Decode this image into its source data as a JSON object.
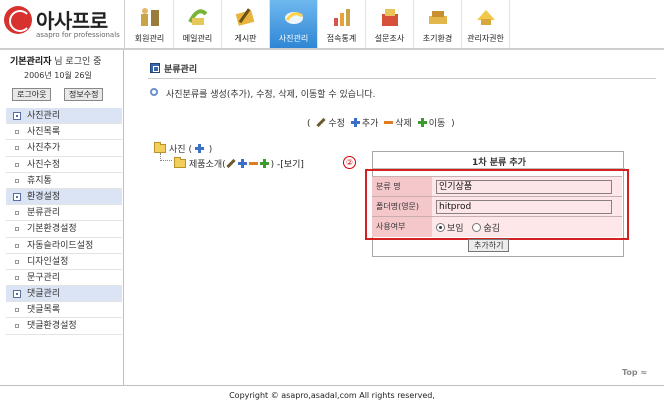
{
  "brand": {
    "name": "아사프로",
    "tagline": "asapro for professionals"
  },
  "colors": {
    "accent": "#2f86d4",
    "highlight_frame": "#d42020",
    "form_label_bg": "#f4c7ca",
    "nav_category_bg": "#dbe4f4"
  },
  "menu": [
    {
      "label": "회원관리",
      "icon": "members-icon"
    },
    {
      "label": "메일관리",
      "icon": "mail-icon"
    },
    {
      "label": "게시판",
      "icon": "board-icon"
    },
    {
      "label": "사진관리",
      "icon": "photo-icon",
      "active": true
    },
    {
      "label": "접속통계",
      "icon": "statistics-icon"
    },
    {
      "label": "설문조사",
      "icon": "survey-icon"
    },
    {
      "label": "초기환경",
      "icon": "init-settings-icon"
    },
    {
      "label": "관리자권한",
      "icon": "admin-permission-icon"
    }
  ],
  "sidebar": {
    "user_name": "기본관리자",
    "user_suffix": " 님 로그인 중",
    "date": "2006년 10월 26일",
    "logout_label": "로그아웃",
    "edit_info_label": "정보수정",
    "nav": [
      {
        "label": "사진관리",
        "type": "category"
      },
      {
        "label": "사진목록",
        "type": "item"
      },
      {
        "label": "사진추가",
        "type": "item"
      },
      {
        "label": "사진수정",
        "type": "item"
      },
      {
        "label": "휴지통",
        "type": "item"
      },
      {
        "label": "환경설정",
        "type": "category"
      },
      {
        "label": "분류관리",
        "type": "item"
      },
      {
        "label": "기본환경설정",
        "type": "item"
      },
      {
        "label": "자동슬라이드설정",
        "type": "item"
      },
      {
        "label": "디자인설정",
        "type": "item"
      },
      {
        "label": "문구관리",
        "type": "item"
      },
      {
        "label": "댓글관리",
        "type": "category"
      },
      {
        "label": "댓글목록",
        "type": "item"
      },
      {
        "label": "댓글환경설정",
        "type": "item"
      }
    ]
  },
  "main": {
    "section_title": "분류관리",
    "description": "사진분류를 생성(추가), 수정, 삭제, 이동할 수 있습니다.",
    "legend": {
      "open": "(",
      "edit": "수정",
      "add": "추가",
      "delete": "삭제",
      "move": "이동",
      "close": ")"
    },
    "tree": {
      "root_label": "사진",
      "root_open": "(",
      "root_close": ")",
      "child_label": "제품소개",
      "child_open": "(",
      "child_close": ")",
      "child_view": "-[보기]"
    },
    "marker": "②",
    "panel": {
      "title": "1차 분류 추가",
      "fields": {
        "name_label": "분류 명",
        "name_value": "인기상품",
        "folder_label": "폴더명(영문)",
        "folder_value": "hitprod",
        "use_label": "사용여부",
        "show_label": "보임",
        "hide_label": "숨김",
        "selected": "보임"
      },
      "submit_label": "추가하기"
    }
  },
  "top_link": "Top",
  "footer": "Copyright © asapro,asadal,com All rights reserved,"
}
